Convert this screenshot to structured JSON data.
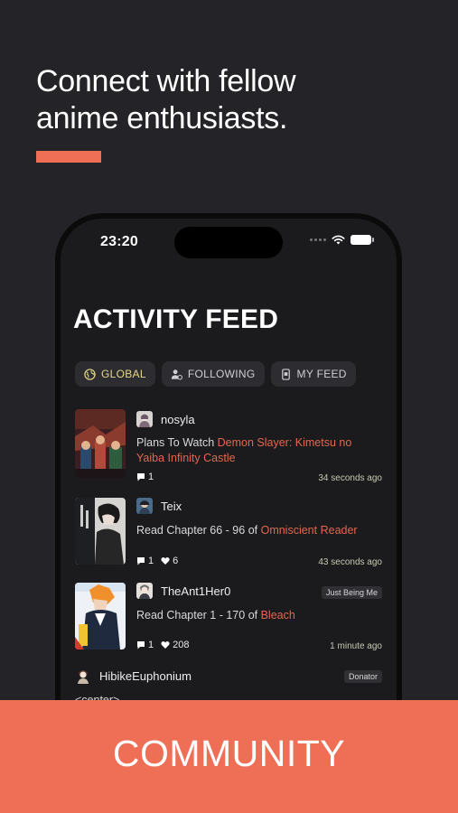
{
  "headline": {
    "line1": "Connect with fellow",
    "line2": "anime enthusiasts."
  },
  "status_bar": {
    "time": "23:20"
  },
  "feed": {
    "title": "ACTIVITY FEED",
    "tabs": [
      {
        "label": "GLOBAL",
        "icon": "globe-icon",
        "active": true
      },
      {
        "label": "FOLLOWING",
        "icon": "user-follow-icon",
        "active": false
      },
      {
        "label": "MY FEED",
        "icon": "phone-icon",
        "active": false
      }
    ],
    "items": [
      {
        "username": "nosyla",
        "action": "Plans To Watch ",
        "title": "Demon Slayer: Kimetsu no Yaiba Infinity Castle",
        "comments": "1",
        "likes": "",
        "time": "34 seconds ago",
        "badge": ""
      },
      {
        "username": "Teix",
        "action": "Read Chapter 66 - 96 of ",
        "title": "Omniscient Reader",
        "comments": "1",
        "likes": "6",
        "time": "43 seconds ago",
        "badge": ""
      },
      {
        "username": "TheAnt1Her0",
        "action": "Read Chapter 1 - 170 of ",
        "title": "Bleach",
        "comments": "1",
        "likes": "208",
        "time": "1 minute ago",
        "badge": "Just Being Me"
      },
      {
        "username": "HibikeEuphonium",
        "badge": "Donator",
        "snippet": "<center>"
      }
    ]
  },
  "cta": {
    "label": "COMMUNITY"
  },
  "colors": {
    "accent": "#ef6f56",
    "background": "#242428",
    "link": "#e2674e",
    "active_tab": "#e5d88a"
  }
}
